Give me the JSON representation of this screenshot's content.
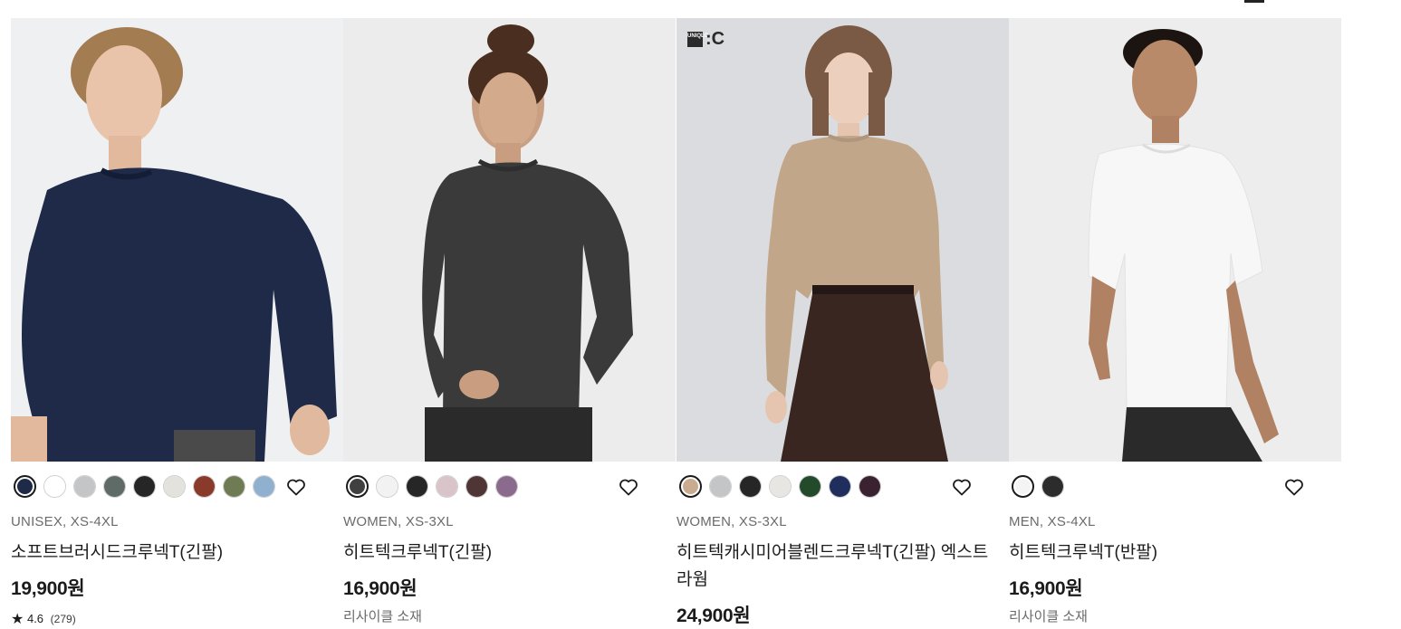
{
  "products": [
    {
      "category": "UNISEX, XS-4XL",
      "name": "소프트브러시드크루넥T(긴팔)",
      "price": "19,900원",
      "rating": "4.6",
      "review_count": "(279)",
      "photo_bg": "#eef0f1",
      "garment_color": "#1e2a48",
      "swatches": [
        "#1e2a48",
        "#ffffff",
        "#c4c5c6",
        "#5f6b67",
        "#262626",
        "#e4e2dd",
        "#8a3a2a",
        "#6f7b52",
        "#8fb1cf"
      ]
    },
    {
      "category": "WOMEN, XS-3XL",
      "name": "히트텍크루넥T(긴팔)",
      "price": "16,900원",
      "note": "리사이클 소재",
      "photo_bg": "#ececec",
      "garment_color": "#3a3a3a",
      "swatches": [
        "#404040",
        "#f2f2f2",
        "#262626",
        "#d9c4c9",
        "#4f3535",
        "#8a6a8d"
      ]
    },
    {
      "category": "WOMEN, XS-3XL",
      "name": "히트텍캐시미어블렌드크루넥T(긴팔) 엑스트라웜",
      "price": "24,900원",
      "brand_badge": "UNIQLO",
      "brand_text": ":C",
      "photo_bg": "#dadcdf",
      "garment_color": "#c2a68a",
      "swatches": [
        "#c9ac8f",
        "#c3c5c7",
        "#262626",
        "#e8e6e2",
        "#234a2b",
        "#1f2e5c",
        "#3b2230"
      ]
    },
    {
      "category": "MEN, XS-4XL",
      "name": "히트텍크루넥T(반팔)",
      "price": "16,900원",
      "note": "리사이클 소재",
      "photo_bg": "#ededed",
      "garment_color": "#f7f7f7",
      "swatches": [
        "#f4f4f4",
        "#2c2c2c"
      ]
    }
  ],
  "icons": {
    "wishlist": "heart-outline-icon",
    "rating": "star-icon"
  }
}
